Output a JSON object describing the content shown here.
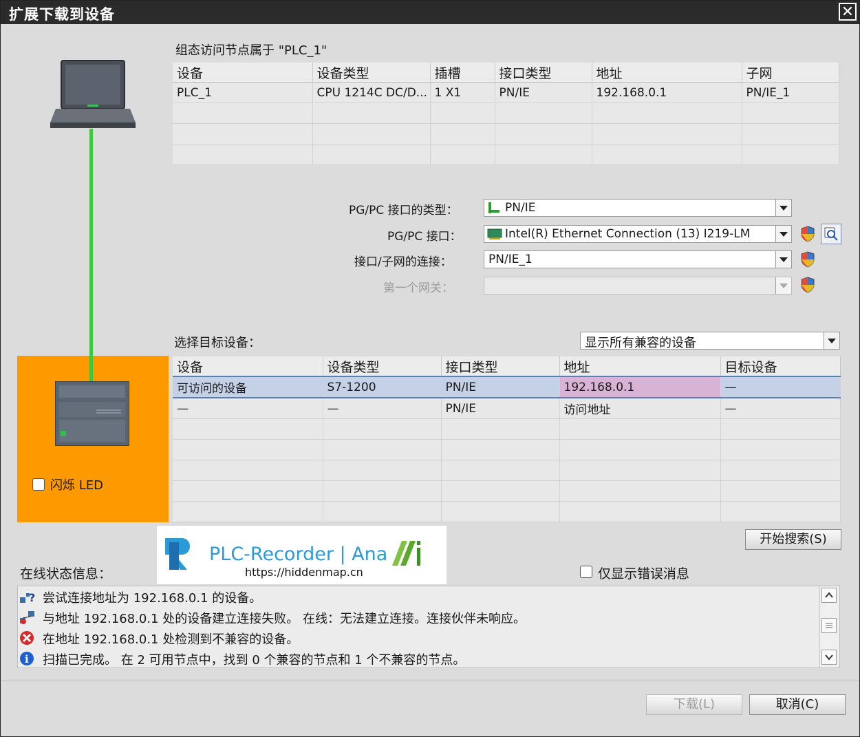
{
  "window": {
    "title": "扩展下载到设备",
    "close_symbol": "✕"
  },
  "config_section": {
    "title": "组态访问节点属于 \"PLC_1\"",
    "columns": [
      "设备",
      "设备类型",
      "插槽",
      "接口类型",
      "地址",
      "子网"
    ],
    "rows": [
      [
        "PLC_1",
        "CPU 1214C DC/D...",
        "1 X1",
        "PN/IE",
        "192.168.0.1",
        "PN/IE_1"
      ]
    ]
  },
  "pgpc": {
    "type_label": "PG/PC 接口的类型：",
    "type_value": "PN/IE",
    "interface_label": "PG/PC 接口：",
    "interface_value": "Intel(R) Ethernet Connection (13) I219-LM",
    "connection_label": "接口/子网的连接：",
    "connection_value": "PN/IE_1",
    "gateway_label": "第一个网关：",
    "gateway_value": ""
  },
  "target_section": {
    "title": "选择目标设备：",
    "filter_value": "显示所有兼容的设备",
    "columns": [
      "设备",
      "设备类型",
      "接口类型",
      "地址",
      "目标设备"
    ],
    "rows": [
      [
        "可访问的设备",
        "S7-1200",
        "PN/IE",
        "192.168.0.1",
        "—"
      ],
      [
        "—",
        "—",
        "PN/IE",
        "访问地址",
        "—"
      ]
    ]
  },
  "device_panel": {
    "flash_led_label": "闪烁 LED",
    "accent_color": "#ff9900"
  },
  "search_button": "开始搜索(S)",
  "watermark": {
    "brand": "PLC-Recorder | Ana",
    "url": "https://hiddenmap.cn"
  },
  "status": {
    "title": "在线状态信息：",
    "errors_only_label": "仅显示错误消息",
    "messages": [
      {
        "icon": "search-network-icon",
        "text": "尝试连接地址为 192.168.0.1 的设备。"
      },
      {
        "icon": "connection-failed-icon",
        "text": "与地址 192.168.0.1 处的设备建立连接失败。 在线：无法建立连接。连接伙伴未响应。"
      },
      {
        "icon": "error-icon",
        "text": "在地址 192.168.0.1 处检测到不兼容的设备。"
      },
      {
        "icon": "info-icon",
        "text": "扫描已完成。 在 2 可用节点中，找到 0 个兼容的节点和 1 个不兼容的节点。"
      }
    ]
  },
  "footer": {
    "download_button": "下载(L)",
    "cancel_button": "取消(C)"
  }
}
